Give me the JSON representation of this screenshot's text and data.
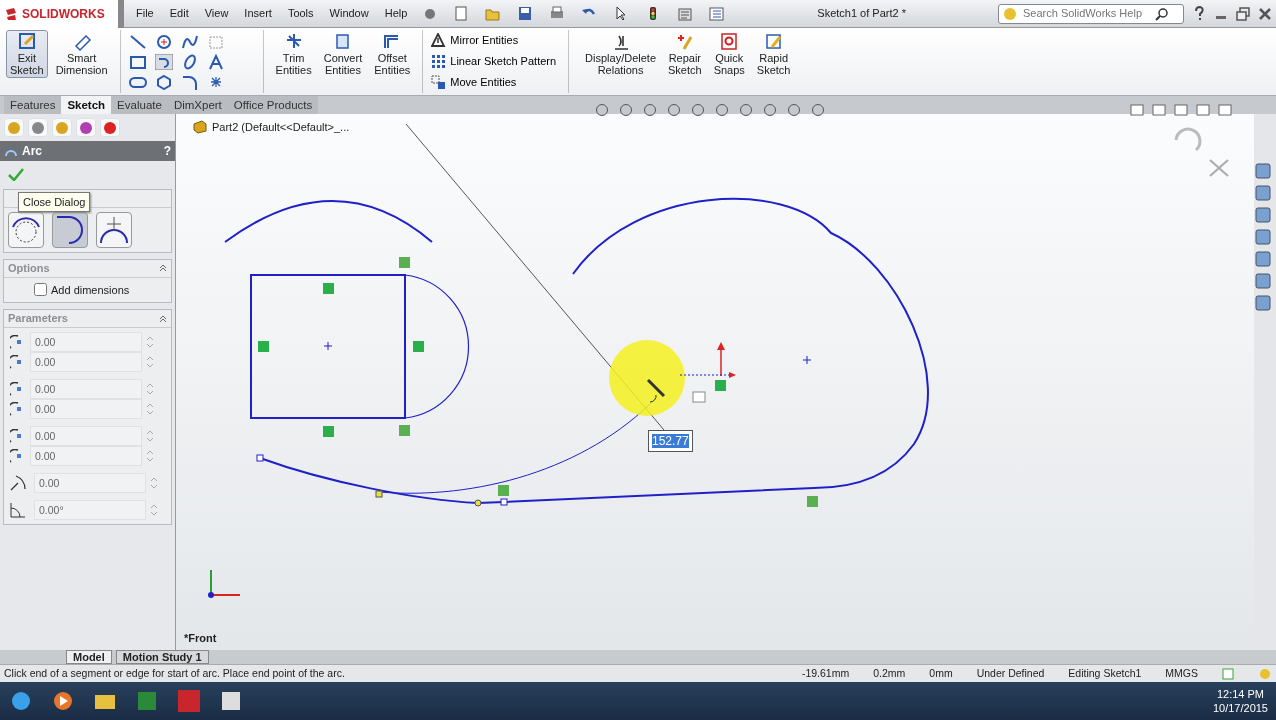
{
  "app": {
    "logo": "SOLIDWORKS",
    "title": "Sketch1 of Part2 *"
  },
  "menu": [
    {
      "label": "File"
    },
    {
      "label": "Edit"
    },
    {
      "label": "View"
    },
    {
      "label": "Insert"
    },
    {
      "label": "Tools"
    },
    {
      "label": "Window"
    },
    {
      "label": "Help"
    }
  ],
  "search": {
    "placeholder": "Search SolidWorks Help"
  },
  "ribbon": [
    {
      "kind": "big",
      "label": "Exit\nSketch",
      "selected": true
    },
    {
      "kind": "big",
      "label": "Smart\nDimension",
      "selected": false
    },
    {
      "kind": "grid"
    },
    {
      "kind": "big",
      "label": "Trim\nEntities",
      "selected": false
    },
    {
      "kind": "big",
      "label": "Convert\nEntities",
      "selected": false
    },
    {
      "kind": "big",
      "label": "Offset\nEntities",
      "selected": false
    },
    {
      "kind": "list",
      "items": [
        {
          "label": "Mirror Entities"
        },
        {
          "label": "Linear Sketch Pattern"
        },
        {
          "label": "Move Entities"
        }
      ]
    },
    {
      "kind": "big",
      "label": "Display/Delete\nRelations",
      "selected": false
    },
    {
      "kind": "big",
      "label": "Repair\nSketch",
      "selected": false
    },
    {
      "kind": "big",
      "label": "Quick\nSnaps",
      "selected": false
    },
    {
      "kind": "big",
      "label": "Rapid\nSketch",
      "selected": false
    }
  ],
  "tabs": [
    {
      "label": "Features",
      "selected": false
    },
    {
      "label": "Sketch",
      "selected": true
    },
    {
      "label": "Evaluate",
      "selected": false
    },
    {
      "label": "DimXpert",
      "selected": false
    },
    {
      "label": "Office Products",
      "selected": false
    }
  ],
  "panel": {
    "title": "Arc",
    "help": "?",
    "tooltip": "Close Dialog",
    "arc_types": [
      {
        "selected": false
      },
      {
        "selected": true
      },
      {
        "selected": false
      }
    ],
    "options": {
      "title": "Options",
      "add_dimensions": {
        "label": "Add dimensions",
        "checked": false
      }
    },
    "parameters": {
      "title": "Parameters",
      "fields": [
        {
          "value": "0.00"
        },
        {
          "value": "0.00"
        },
        {
          "value": "0.00"
        },
        {
          "value": "0.00"
        },
        {
          "value": "0.00"
        },
        {
          "value": "0.00"
        },
        {
          "value": "0.00"
        },
        {
          "value": "0.00°"
        }
      ]
    }
  },
  "graphics": {
    "tree_label": "Part2  (Default<<Default>_...",
    "view_label": "*Front",
    "dimension": "152.77"
  },
  "bottom_tabs": [
    {
      "label": "Model",
      "selected": true
    },
    {
      "label": "Motion Study 1",
      "selected": false
    }
  ],
  "status": {
    "prompt": "Click end of a segment or edge for start of arc.  Place end point of the arc.",
    "items": [
      {
        "label": "-19.61mm"
      },
      {
        "label": "0.2mm"
      },
      {
        "label": "0mm"
      },
      {
        "label": "Under Defined"
      },
      {
        "label": "Editing Sketch1"
      },
      {
        "label": "MMGS"
      }
    ]
  },
  "taskbar": {
    "time": "12:14 PM",
    "date": "10/17/2015"
  }
}
